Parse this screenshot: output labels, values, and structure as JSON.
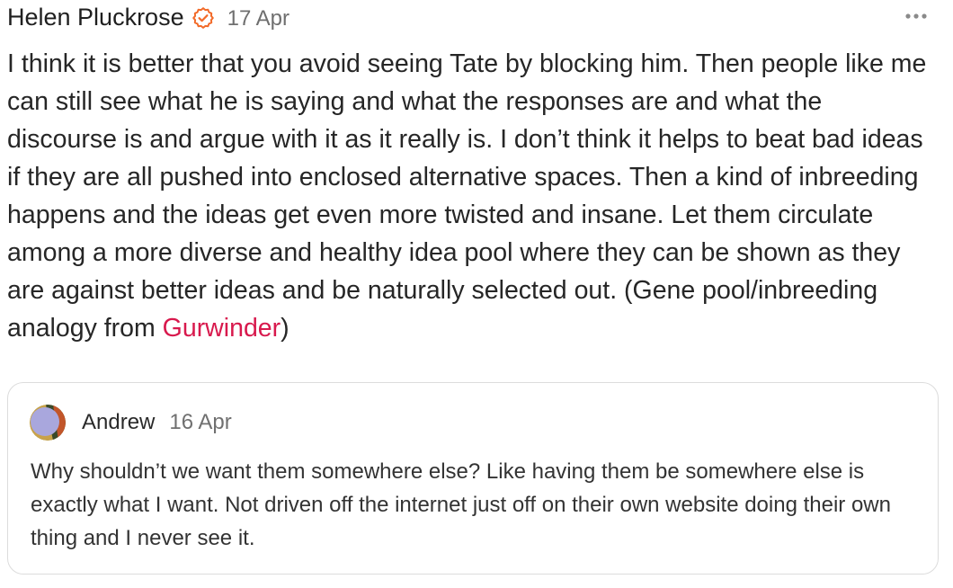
{
  "note": {
    "author": "Helen Pluckrose",
    "timestamp": "17 Apr",
    "body_before": "I think it is better that you avoid seeing Tate by blocking him. Then people like me can still see what he is saying and what the responses are and what the discourse is and argue with it as it really is. I don’t think it helps to beat bad ideas if they are all pushed into enclosed alternative spaces. Then a kind of inbreeding happens and the ideas get even more twisted and insane. Let them circulate among a more diverse and healthy idea pool where they can be shown as they are against better ideas and be naturally selected out. (Gene pool/inbreeding analogy from ",
    "mention": "Gurwinder",
    "body_after": ")",
    "icons": {
      "verified": "verified-check-icon",
      "more": "more-options-icon"
    }
  },
  "quote": {
    "author": "Andrew",
    "timestamp": "16 Apr",
    "text": "Why shouldn’t we want them somewhere else? Like having them be somewhere else is exactly what I want. Not driven off the internet just off on their own website doing their own thing and I never see it."
  },
  "colors": {
    "accent": "#d8194d",
    "verified": "#f26b2a",
    "muted": "#6f6f6f",
    "border": "#dcdcdc"
  }
}
